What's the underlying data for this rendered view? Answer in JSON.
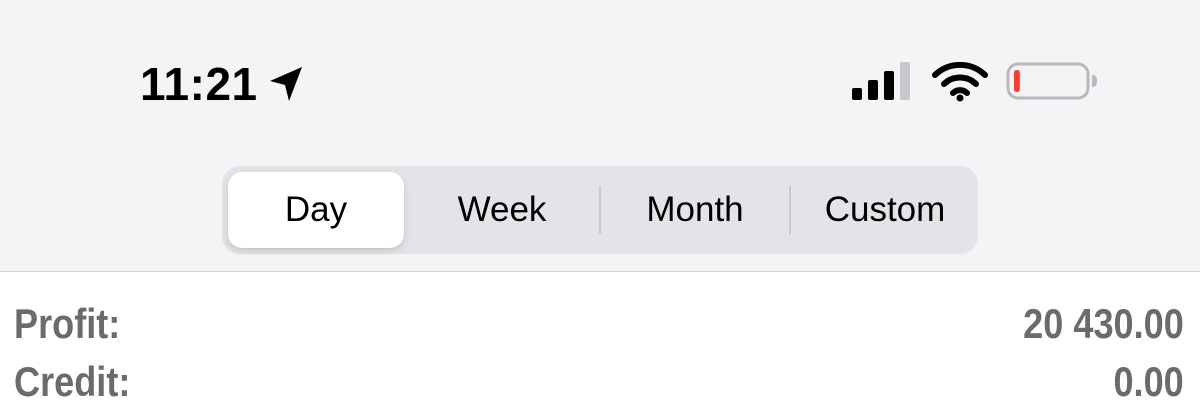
{
  "status_bar": {
    "time": "11:21",
    "icons": [
      "location-arrow-icon",
      "cellular-signal-icon",
      "wifi-icon",
      "battery-icon"
    ],
    "battery_level": 0.05,
    "battery_low_color": "#ff3b30"
  },
  "segmented_control": {
    "selected": "Day",
    "segments": [
      {
        "label": "Day"
      },
      {
        "label": "Week"
      },
      {
        "label": "Month"
      },
      {
        "label": "Custom"
      }
    ]
  },
  "summary": {
    "profit_label": "Profit:",
    "profit_value": "20 430.00",
    "credit_label": "Credit:",
    "credit_value": "0.00"
  },
  "colors": {
    "header_bg": "#f4f4f7",
    "segment_track": "#e4e4e8",
    "segment_selected": "#ffffff",
    "summary_text": "#6b6b6b"
  }
}
